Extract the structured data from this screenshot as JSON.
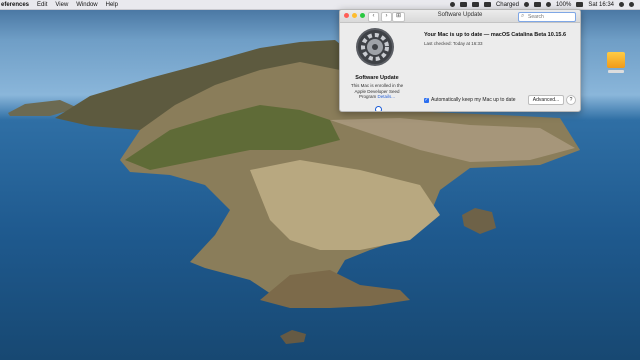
{
  "menubar": {
    "app_name": "eferences",
    "items": [
      "Edit",
      "View",
      "Window",
      "Help"
    ],
    "battery_status": "Charged",
    "battery_percent": "100%",
    "clock": "Sat 16:34"
  },
  "window": {
    "title": "Software Update",
    "search_placeholder": "Search",
    "sidebar": {
      "title": "Software Update",
      "enrolled_text": "This Mac is enrolled in the Apple Developer Seed Program",
      "details_link": "Details..."
    },
    "status": "Your Mac is up to date — macOS Catalina Beta 10.15.6",
    "last_checked": "Last checked: Today at 16:33",
    "auto_update_label": "Automatically keep my Mac up to date",
    "advanced_button": "Advanced...",
    "help_button": "?"
  }
}
